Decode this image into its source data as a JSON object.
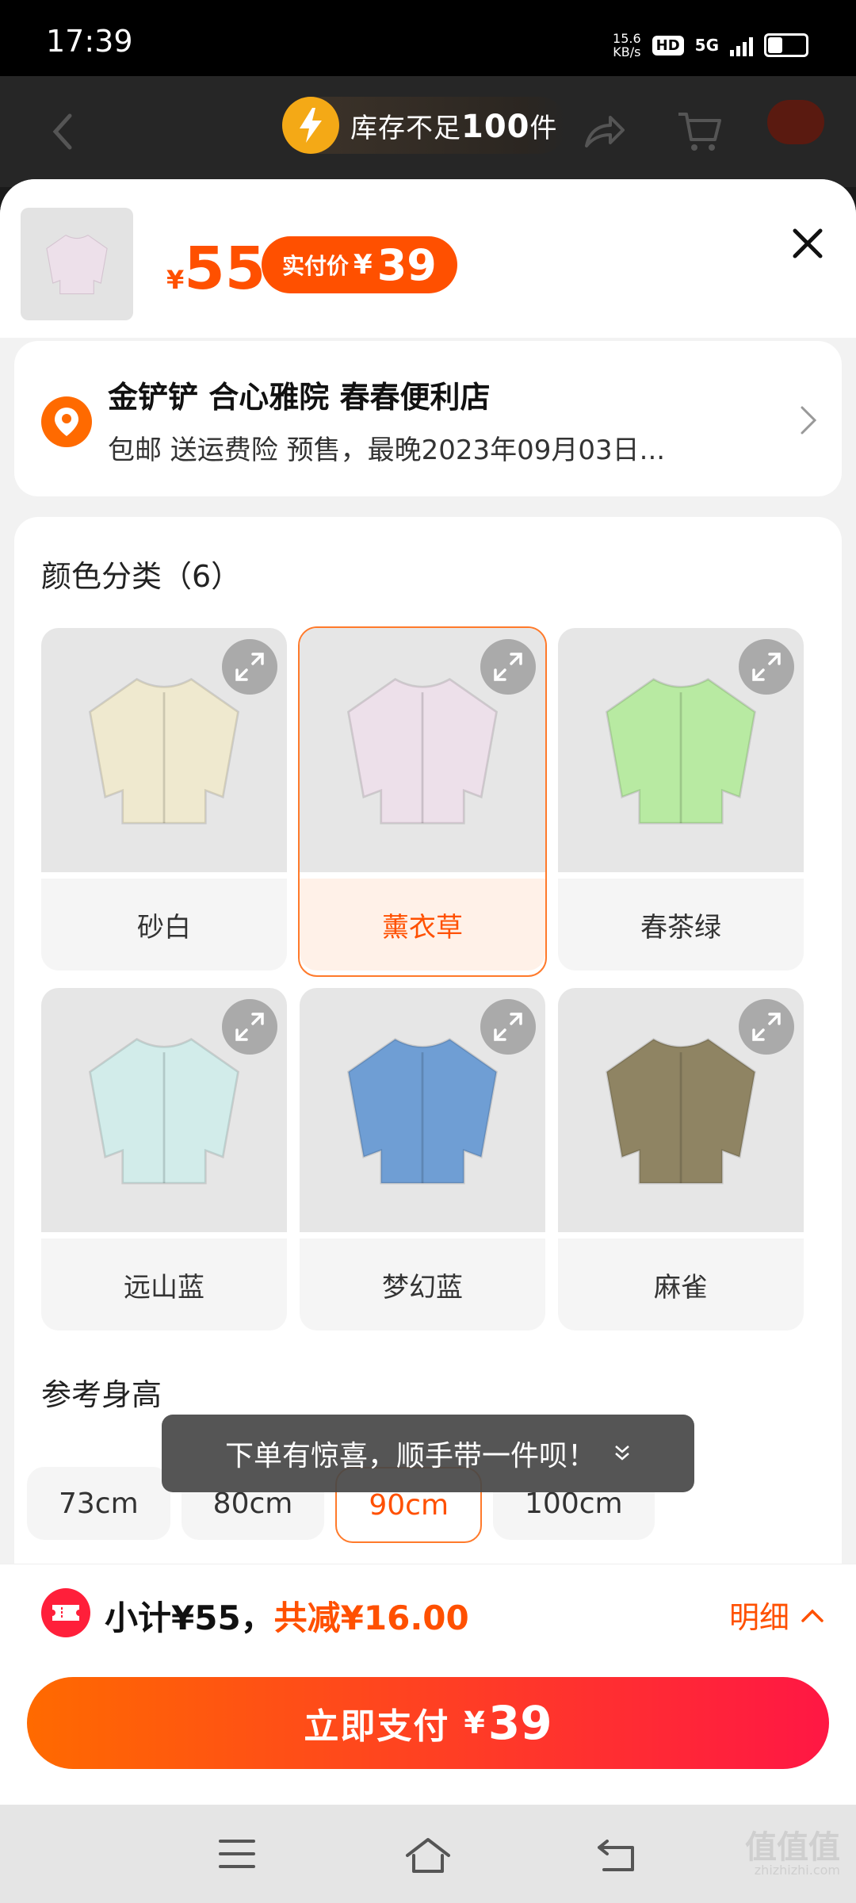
{
  "status_bar": {
    "time": "17:39",
    "net_speed_value": "15.6",
    "net_speed_unit": "KB/s",
    "hd": "HD",
    "network": "5G"
  },
  "stock_notice": {
    "prefix": "库存不足",
    "count": "100",
    "suffix": "件"
  },
  "product": {
    "currency": "¥",
    "price": "55",
    "paid_label": "实付价",
    "paid_currency": "¥",
    "paid_price": "39"
  },
  "address": {
    "title": "金铲铲 合心雅院 春春便利店",
    "subtitle": "包邮 送运费险 预售，最晚2023年09月03日..."
  },
  "color_section": {
    "title": "颜色分类（6）",
    "options": [
      {
        "label": "砂白",
        "swatch": "#efe9cf",
        "selected": false
      },
      {
        "label": "薰衣草",
        "swatch": "#ede0ea",
        "selected": true
      },
      {
        "label": "春茶绿",
        "swatch": "#b8eaa2",
        "selected": false
      },
      {
        "label": "远山蓝",
        "swatch": "#d2ecea",
        "selected": false
      },
      {
        "label": "梦幻蓝",
        "swatch": "#6f9ed4",
        "selected": false
      },
      {
        "label": "麻雀",
        "swatch": "#8f8463",
        "selected": false
      }
    ]
  },
  "size_section": {
    "title": "参考身高",
    "options": [
      {
        "label": "73cm",
        "selected": false
      },
      {
        "label": "80cm",
        "selected": false
      },
      {
        "label": "90cm",
        "selected": true
      },
      {
        "label": "100cm",
        "selected": false
      }
    ]
  },
  "toast": {
    "text": "下单有惊喜，顺手带一件呗！"
  },
  "footer": {
    "subtotal_text": "小计¥55，",
    "discount_text": "共减¥16.00",
    "detail_label": "明细",
    "pay_label": "立即支付",
    "pay_currency": "¥",
    "pay_amount": "39"
  },
  "watermark": {
    "text": "值值值",
    "sub": "zhizhizhi.com"
  },
  "colors": {
    "accent": "#ff5000",
    "pay_gradient_start": "#ff6a00",
    "pay_gradient_end": "#ff1744",
    "bolt": "#f4a916"
  }
}
